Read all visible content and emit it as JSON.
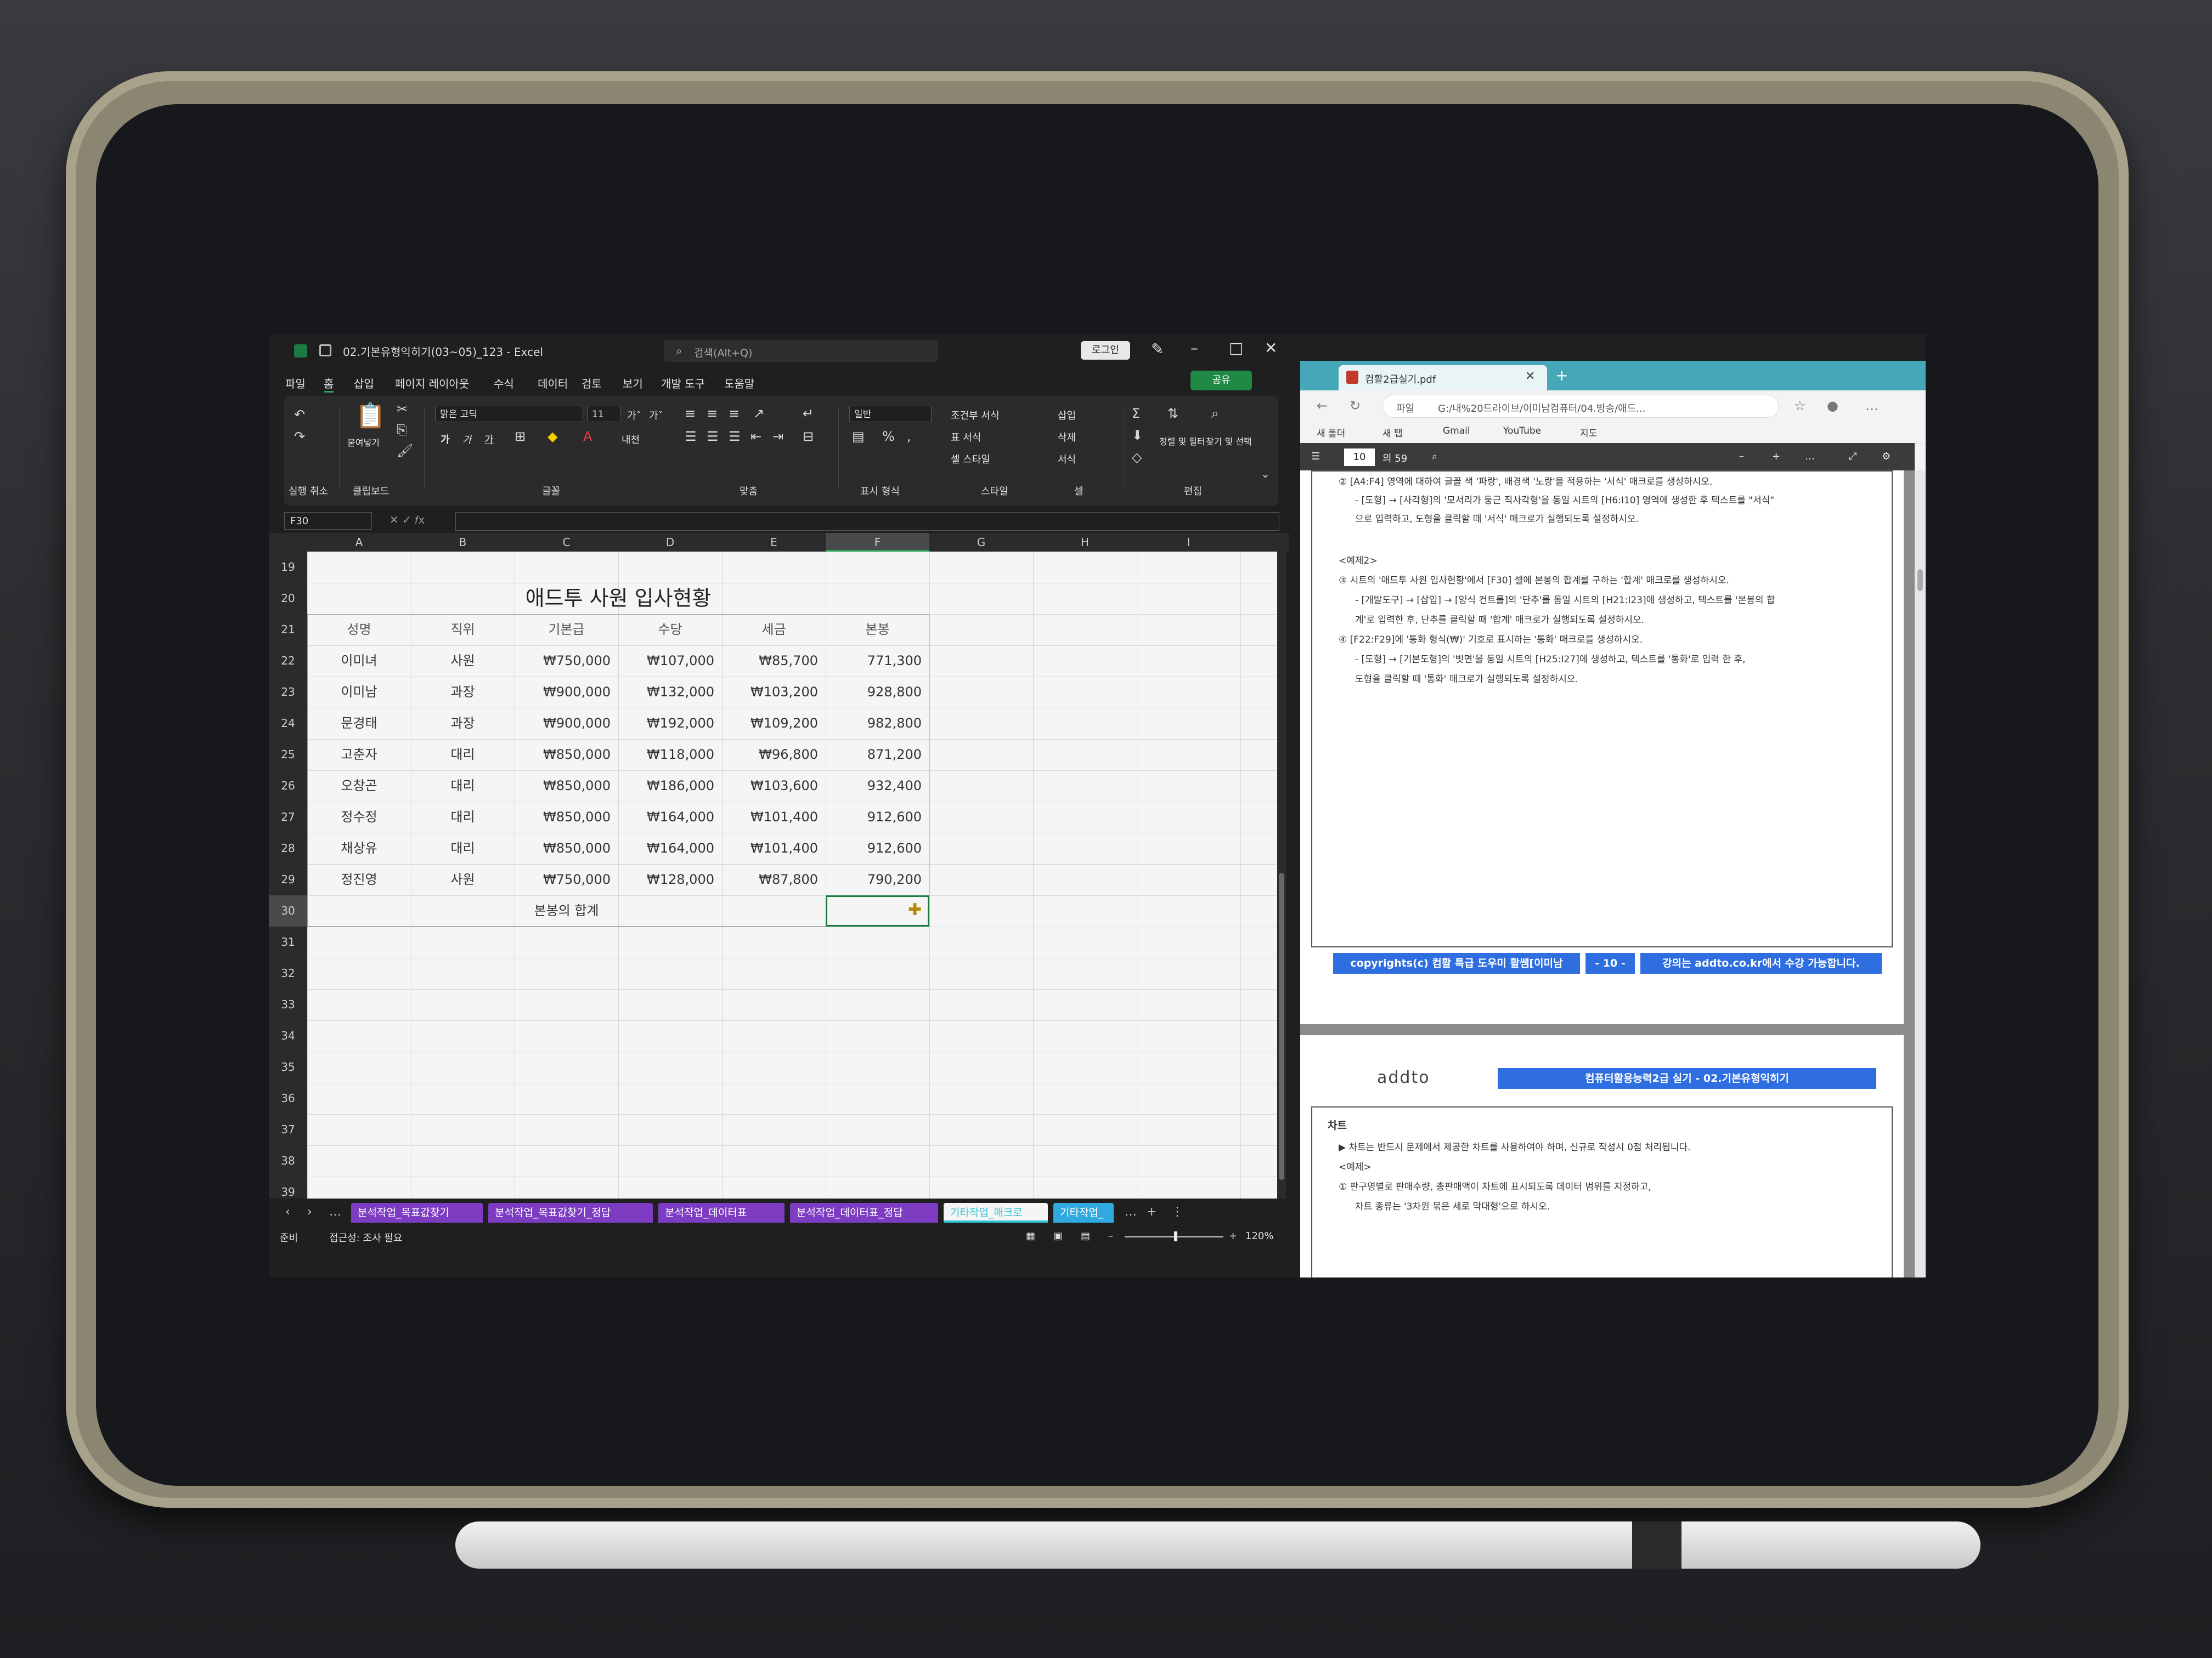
{
  "excel": {
    "doc_title": "02.기본유형익히기(03~05)_123 - Excel",
    "search_placeholder": "검색(Alt+Q)",
    "login_label": "로그인",
    "share_label": "공유",
    "menu": [
      "파일",
      "홈",
      "삽입",
      "페이지 레이아웃",
      "수식",
      "데이터",
      "검토",
      "보기",
      "개발 도구",
      "도움말"
    ],
    "ribbon": {
      "undo_label": "실행 취소",
      "clipboard_label": "클립보드",
      "paste_label": "붙여넣기",
      "font_group_label": "글꼴",
      "font_name": "맑은 고딕",
      "font_size": "11",
      "align_group_label": "맞춤",
      "number_group_label": "표시 형식",
      "number_format": "일반",
      "style_group_label": "스타일",
      "conditional_format": "조건부 서식",
      "table_format": "표 서식",
      "cell_style": "셀 스타일",
      "cells_group_label": "셀",
      "insert_label": "삽입",
      "delete_label": "삭제",
      "format_label": "서식",
      "edit_group_label": "편집",
      "sort_filter_label": "정렬 및 필터",
      "find_select_label": "찾기 및 선택"
    },
    "name_box": "F30",
    "columns": [
      "A",
      "B",
      "C",
      "D",
      "E",
      "F",
      "G",
      "H",
      "I"
    ],
    "selected_column": "F",
    "rows": [
      "19",
      "20",
      "21",
      "22",
      "23",
      "24",
      "25",
      "26",
      "27",
      "28",
      "29",
      "30",
      "31",
      "32",
      "33",
      "34",
      "35",
      "36",
      "37",
      "38",
      "39"
    ],
    "selected_row": "30",
    "sheet_title": "애드투 사원 입사현황",
    "table_headers": [
      "성명",
      "직위",
      "기본급",
      "수당",
      "세금",
      "본봉"
    ],
    "table_rows": [
      [
        "이미녀",
        "사원",
        "₩750,000",
        "₩107,000",
        "₩85,700",
        "771,300"
      ],
      [
        "이미남",
        "과장",
        "₩900,000",
        "₩132,000",
        "₩103,200",
        "928,800"
      ],
      [
        "문경태",
        "과장",
        "₩900,000",
        "₩192,000",
        "₩109,200",
        "982,800"
      ],
      [
        "고춘자",
        "대리",
        "₩850,000",
        "₩118,000",
        "₩96,800",
        "871,200"
      ],
      [
        "오창곤",
        "대리",
        "₩850,000",
        "₩186,000",
        "₩103,600",
        "932,400"
      ],
      [
        "정수정",
        "대리",
        "₩850,000",
        "₩164,000",
        "₩101,400",
        "912,600"
      ],
      [
        "채상유",
        "대리",
        "₩850,000",
        "₩164,000",
        "₩101,400",
        "912,600"
      ],
      [
        "정진영",
        "사원",
        "₩750,000",
        "₩128,000",
        "₩87,800",
        "790,200"
      ]
    ],
    "total_label": "본봉의 합계",
    "sheet_tabs": [
      {
        "label": "분석작업_목표값찾기",
        "color": "#7d3cc2",
        "active": false
      },
      {
        "label": "분석작업_목표값찾기_정답",
        "color": "#7d3cc2",
        "active": false
      },
      {
        "label": "분석작업_데이터표",
        "color": "#7d3cc2",
        "active": false
      },
      {
        "label": "분석작업_데이터표_정답",
        "color": "#7d3cc2",
        "active": false
      },
      {
        "label": "기타작업_매크로",
        "color": "#2fc4d6",
        "active": true
      },
      {
        "label": "기타작업_",
        "color": "#2fa9e0",
        "active": false
      }
    ],
    "status_ready": "준비",
    "status_accessibility": "접근성: 조사 필요",
    "zoom": "120%"
  },
  "edge": {
    "tab_title": "컴활2급실기.pdf",
    "address_prefix": "파일",
    "address": "G:/내%20드라이브/이미남컴퓨터/04.방송/애드...",
    "bookmarks": [
      "새 폴더",
      "새 탭",
      "Gmail",
      "YouTube",
      "지도"
    ],
    "pdf_page": "10",
    "pdf_total": "의 59",
    "pdf_lines_top": [
      "② [A4:F4] 영역에 대하여 글꼴 색 '파랑', 배경색 '노랑'을 적용하는 '서식' 매크로를 생성하시오.",
      "- [도형] → [사각형]의 '모서리가 둥근 직사각형'을 동일 시트의 [H6:I10] 영역에 생성한 후 텍스트를 \"서식\"",
      "으로 입력하고, 도형을 클릭할 때 '서식' 매크로가 실행되도록 설정하시오.",
      "<예제2>",
      "③ 시트의 '애드투 사원 입사현황'에서 [F30] 셀에 본봉의 합계를 구하는 '합계' 매크로를 생성하시오.",
      "- [개발도구] → [삽입] → [양식 컨트롤]의 '단추'를 동일 시트의 [H21:I23]에 생성하고, 텍스트를 '본봉의 합",
      "계'로 입력한 후, 단추를 클릭할 때 '합계' 매크로가 실행되도록 설정하시오.",
      "④ [F22:F29]에 '통화 형식(₩)' 기호로 표시하는 '통화' 매크로를 생성하시오.",
      "- [도형] → [기본도형]의 '빗면'을 동일 시트의 [H25:I27]에 생성하고, 텍스트를 '통화'로 입력 한 후,",
      "도형을 클릭할 때 '통화' 매크로가 실행되도록 설정하시오."
    ],
    "footer_copyright": "copyrights(c) 컴활 특급 도우미 활쌤[이미남",
    "footer_page": "- 10 -",
    "footer_site": "강의는 addto.co.kr에서 수강 가능합니다.",
    "logo": "addto",
    "header_banner": "컴퓨터활용능력2급 실기 - 02.기본유형익히기",
    "section_title": "차트",
    "pdf_lines_bottom": [
      "▶ 차트는 반드시 문제에서 제공한 차트를 사용하여야 하며, 신규로 작성시 0점 처리됩니다.",
      "<예제>",
      "① 판구명별로 판매수량, 총판매액이 차트에 표시되도록 데이터 범위를 지정하고,",
      "차트 종류는 '3차원 묶은 세로 막대형'으로 하시오."
    ]
  }
}
